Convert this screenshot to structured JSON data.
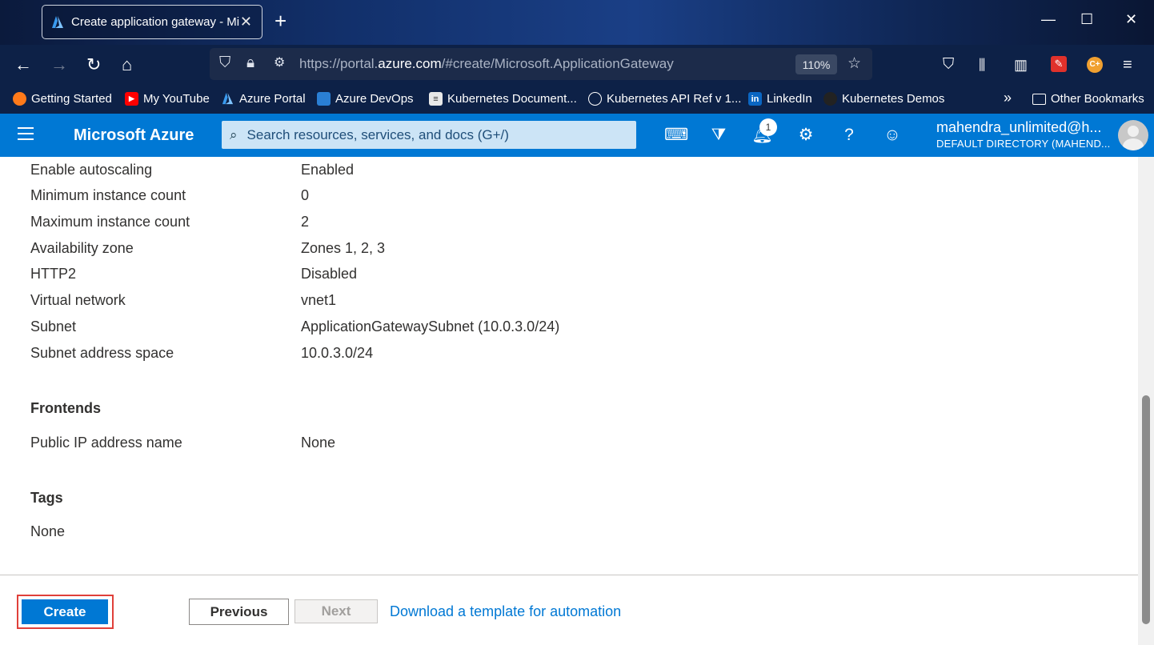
{
  "browser": {
    "tab_title": "Create application gateway - Microsoft Azure",
    "tab_title_visible": "Create application gateway - Mi",
    "url_prefix": "https://portal.",
    "url_domain": "azure.com",
    "url_suffix": "/#create/Microsoft.ApplicationGateway",
    "zoom": "110%"
  },
  "bookmarks": [
    {
      "label": "Getting Started",
      "icon": "firefox-icon"
    },
    {
      "label": "My YouTube",
      "icon": "youtube-icon"
    },
    {
      "label": "Azure Portal",
      "icon": "azure-icon"
    },
    {
      "label": "Azure DevOps",
      "icon": "devops-icon"
    },
    {
      "label": "Kubernetes Document...",
      "icon": "document-icon"
    },
    {
      "label": "Kubernetes API Ref v 1...",
      "icon": "globe-icon"
    },
    {
      "label": "LinkedIn",
      "icon": "linkedin-icon"
    },
    {
      "label": "Kubernetes Demos",
      "icon": "github-icon"
    }
  ],
  "bookmarks_other": "Other Bookmarks",
  "azure": {
    "brand": "Microsoft Azure",
    "search_placeholder": "Search resources, services, and docs (G+/)",
    "notification_count": "1",
    "account_name": "mahendra_unlimited@h...",
    "account_directory": "DEFAULT DIRECTORY (MAHEND..."
  },
  "details": [
    {
      "key": "Enable autoscaling",
      "value": "Enabled"
    },
    {
      "key": "Minimum instance count",
      "value": "0"
    },
    {
      "key": "Maximum instance count",
      "value": "2"
    },
    {
      "key": "Availability zone",
      "value": "Zones 1, 2, 3"
    },
    {
      "key": "HTTP2",
      "value": "Disabled"
    },
    {
      "key": "Virtual network",
      "value": "vnet1"
    },
    {
      "key": "Subnet",
      "value": "ApplicationGatewaySubnet (10.0.3.0/24)"
    },
    {
      "key": "Subnet address space",
      "value": "10.0.3.0/24"
    }
  ],
  "frontends": {
    "title": "Frontends",
    "key": "Public IP address name",
    "value": "None"
  },
  "tags": {
    "title": "Tags",
    "value": "None"
  },
  "footer": {
    "create": "Create",
    "previous": "Previous",
    "next": "Next",
    "template_link": "Download a template for automation"
  }
}
